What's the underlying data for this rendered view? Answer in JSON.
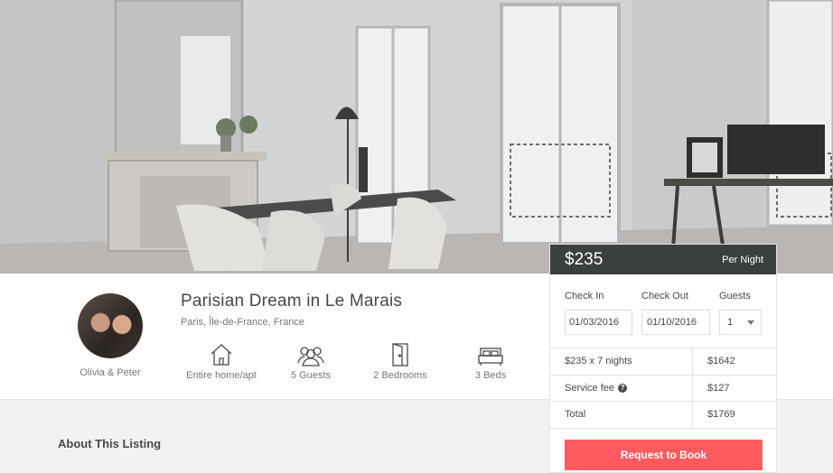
{
  "listing": {
    "title": "Parisian Dream in Le Marais",
    "location": "Paris, Île-de-France, France",
    "host_name": "Olivia & Peter"
  },
  "amenities": [
    {
      "icon": "home-icon",
      "label": "Entire home/apt"
    },
    {
      "icon": "guests-icon",
      "label": "5 Guests"
    },
    {
      "icon": "door-icon",
      "label": "2 Bedrooms"
    },
    {
      "icon": "bed-icon",
      "label": "3 Beds"
    }
  ],
  "about": {
    "title": "About This Listing"
  },
  "booking": {
    "price": "$235",
    "per_night": "Per Night",
    "checkin_label": "Check In",
    "checkout_label": "Check Out",
    "guests_label": "Guests",
    "checkin_value": "01/03/2016",
    "checkout_value": "01/10/2016",
    "guests_value": "1",
    "rows": [
      {
        "label": "$235 x 7 nights",
        "value": "$1642"
      },
      {
        "label": "Service fee",
        "value": "$127"
      },
      {
        "label": "Total",
        "value": "$1769"
      }
    ],
    "help_glyph": "?",
    "button": "Request to Book",
    "accent_color": "#ff5a5f",
    "header_color": "#3c3f40"
  }
}
